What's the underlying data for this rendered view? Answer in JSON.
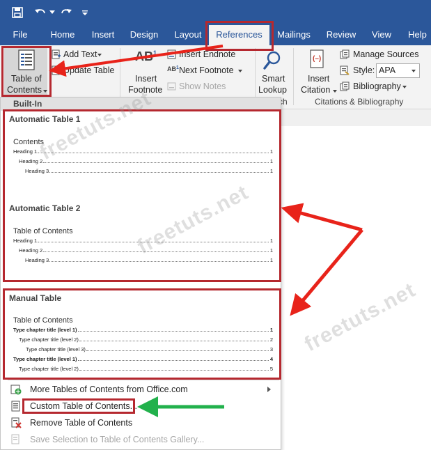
{
  "titlebar": {
    "quick_access": [
      "save-icon",
      "undo-icon",
      "redo-icon",
      "customize-icon"
    ],
    "background": "#2b579a"
  },
  "tabs": [
    "File",
    "Home",
    "Insert",
    "Design",
    "Layout",
    "References",
    "Mailings",
    "Review",
    "View",
    "Help"
  ],
  "active_tab": "References",
  "ribbon": {
    "toc_button": {
      "line1": "Table of",
      "line2": "Contents"
    },
    "add_text": "Add Text",
    "update_table": "Update Table",
    "insert_footnote": {
      "icon_text": "AB",
      "line1": "Insert",
      "line2": "Footnote"
    },
    "insert_endnote": "Insert Endnote",
    "next_footnote": "Next Footnote",
    "show_notes": "Show Notes",
    "smart_lookup": {
      "line1": "Smart",
      "line2": "Lookup"
    },
    "insight_label_fragment": "ch",
    "insert_citation": {
      "line1": "Insert",
      "line2": "Citation"
    },
    "manage_sources": "Manage Sources",
    "style_label": "Style:",
    "style_value": "APA",
    "bibliography": "Bibliography",
    "citations_group_label": "Citations & Bibliography"
  },
  "dropdown": {
    "header": "Built-In",
    "automatic1": {
      "title": "Automatic Table 1",
      "heading": "Contents",
      "rows": [
        {
          "label": "Heading 1",
          "page": "1"
        },
        {
          "label": "Heading 2",
          "page": "1"
        },
        {
          "label": "Heading 3",
          "page": "1"
        }
      ]
    },
    "automatic2": {
      "title": "Automatic Table 2",
      "heading": "Table of Contents",
      "rows": [
        {
          "label": "Heading 1",
          "page": "1"
        },
        {
          "label": "Heading 2",
          "page": "1"
        },
        {
          "label": "Heading 3",
          "page": "1"
        }
      ]
    },
    "manual": {
      "title": "Manual Table",
      "heading": "Table of Contents",
      "rows": [
        {
          "label": "Type chapter title (level 1)",
          "page": "1"
        },
        {
          "label": "Type chapter title (level 2)",
          "page": "2"
        },
        {
          "label": "Type chapter title (level 3)",
          "page": "3"
        },
        {
          "label": "Type chapter title (level 1)",
          "page": "4"
        },
        {
          "label": "Type chapter title (level 2)",
          "page": "5"
        }
      ]
    },
    "menu": {
      "more": "More Tables of Contents from Office.com",
      "custom": "Custom Table of Contents...",
      "remove": "Remove Table of Contents",
      "save": "Save Selection to Table of Contents Gallery..."
    }
  },
  "watermark": "freetuts.net",
  "colors": {
    "highlight_box": "#b5282f",
    "arrow_red": "#e8231a",
    "arrow_green": "#22b14c"
  }
}
